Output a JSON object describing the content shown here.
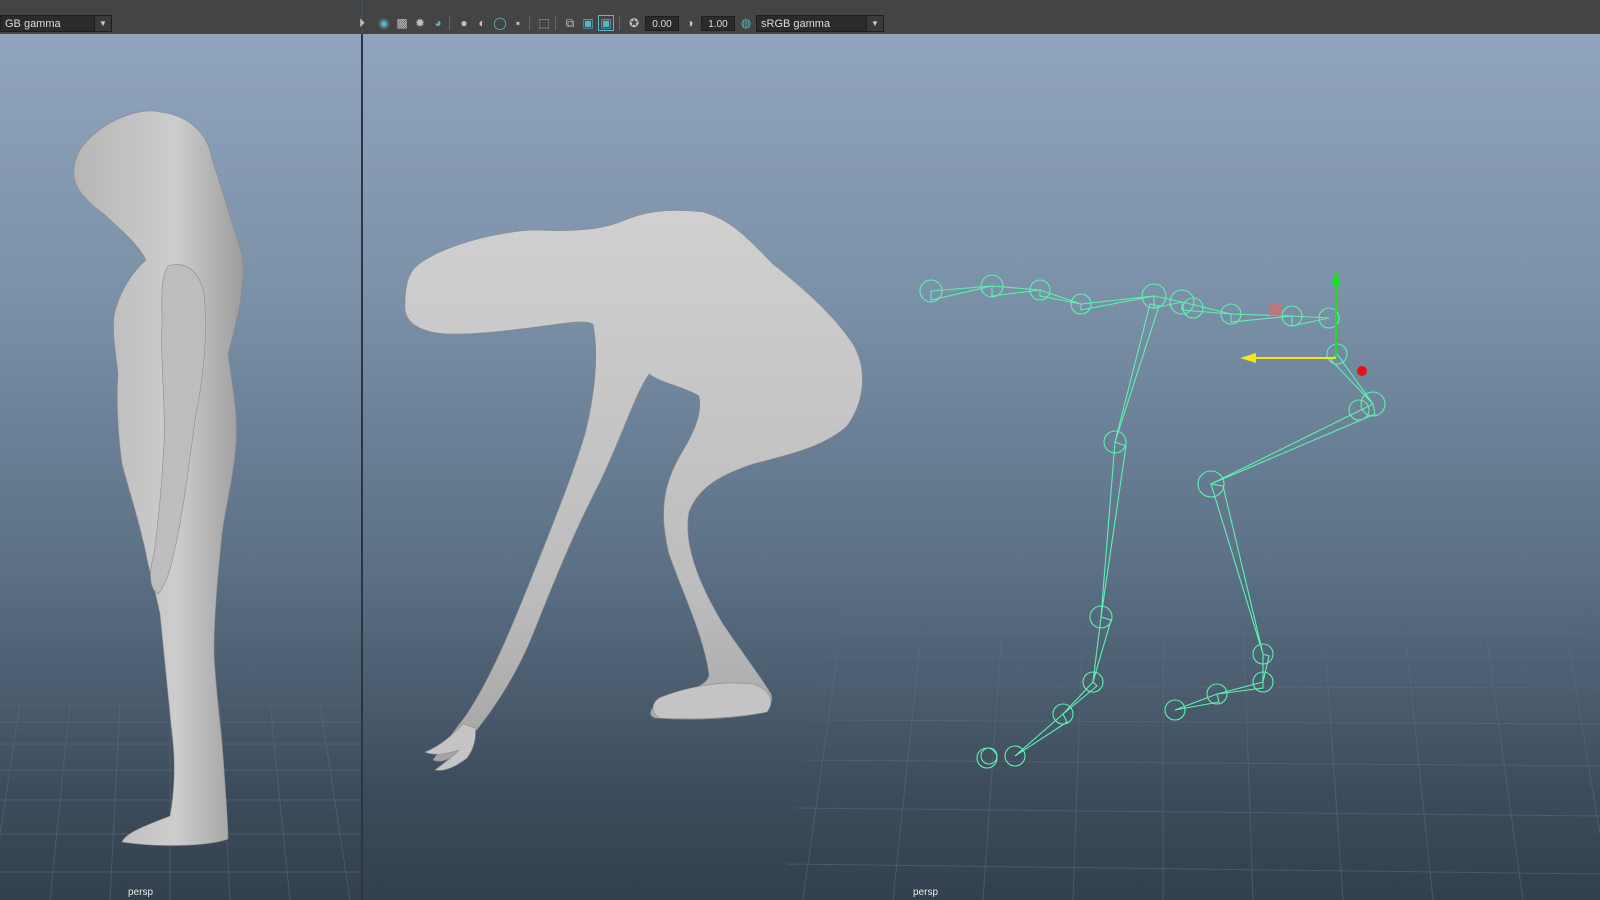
{
  "left_panel": {
    "color_space": "GB gamma",
    "camera_label": "persp"
  },
  "main_panel": {
    "exposure": "0.00",
    "gamma": "1.00",
    "color_space": "sRGB gamma",
    "camera_label": "persp"
  },
  "toolbar_icons": [
    "camera-attributes-icon",
    "isolate-select-icon",
    "xray-icon",
    "lights-icon",
    "shadows-icon",
    "smooth-shade-icon",
    "wireframe-on-shaded-icon",
    "textured-icon",
    "use-default-material-icon",
    "select-camera-icon",
    "resolution-gate-icon",
    "film-gate-icon",
    "safe-action-icon",
    "exposure-icon",
    "gamma-icon",
    "color-management-icon"
  ],
  "colors": {
    "viewport_top": "#90a5bd",
    "viewport_bottom": "#33414e",
    "toolbar": "#444444",
    "joint": "#5ff0b0",
    "mesh": "#c6c6c6",
    "move_y_axis": "#22dd22",
    "move_x_axis": "#f2e61a",
    "move_z_axis": "#e31414"
  }
}
